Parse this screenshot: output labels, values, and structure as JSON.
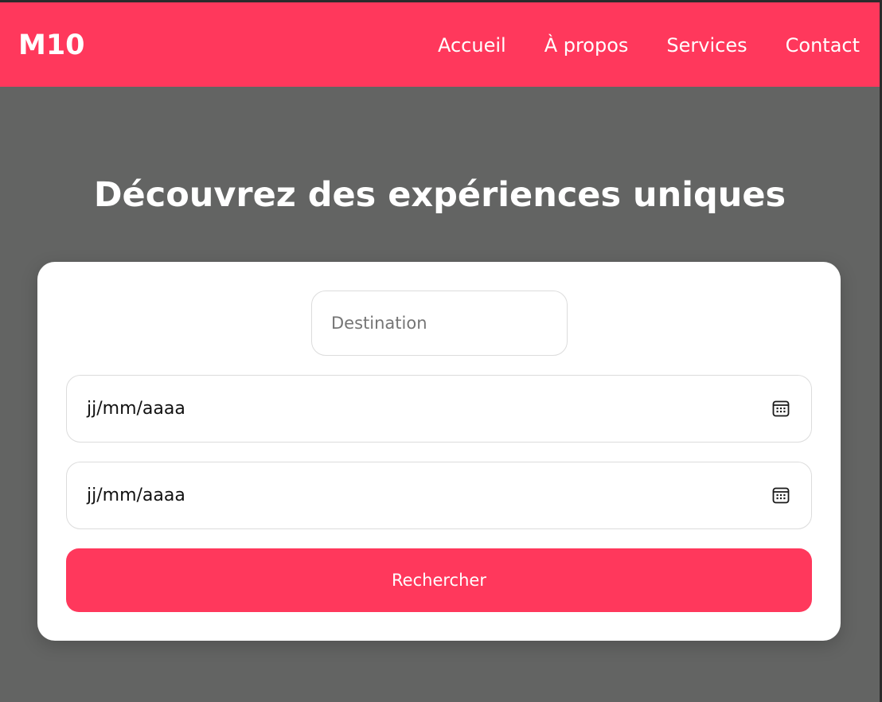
{
  "nav": {
    "logo": "M10",
    "links": [
      "Accueil",
      "À propos",
      "Services",
      "Contact"
    ]
  },
  "hero": {
    "title": "Découvrez des expériences uniques"
  },
  "search": {
    "destination_placeholder": "Destination",
    "date_start_placeholder": "jj/mm/aaaa",
    "date_end_placeholder": "jj/mm/aaaa",
    "button_label": "Rechercher"
  },
  "colors": {
    "brand": "#ff385c",
    "background": "#636463",
    "card": "#ffffff"
  },
  "icons": [
    "calendar-icon",
    "calendar-icon"
  ]
}
